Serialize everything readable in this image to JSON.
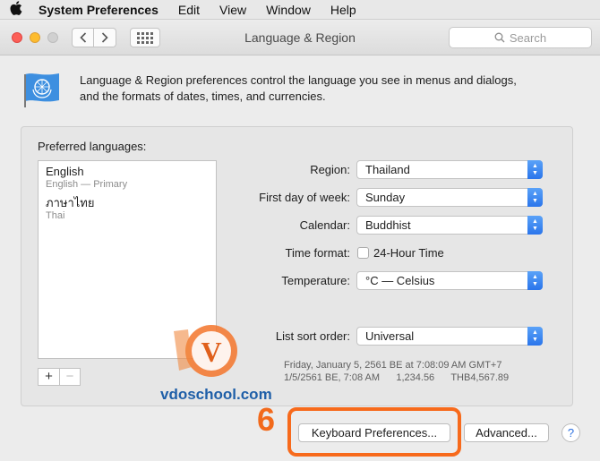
{
  "menubar": {
    "apple_icon": "apple-logo",
    "items": [
      "System Preferences",
      "Edit",
      "View",
      "Window",
      "Help"
    ]
  },
  "window": {
    "title": "Language & Region",
    "search_placeholder": "Search"
  },
  "intro": {
    "icon": "un-flag-icon",
    "text_line1": "Language & Region preferences control the language you see in menus and dialogs,",
    "text_line2": "and the formats of dates, times, and currencies."
  },
  "languages": {
    "label": "Preferred languages:",
    "items": [
      {
        "name": "English",
        "sub": "English — Primary"
      },
      {
        "name": "ภาษาไทย",
        "sub": "Thai"
      }
    ],
    "add": "+",
    "remove": "−"
  },
  "settings": {
    "region_label": "Region:",
    "region_value": "Thailand",
    "first_day_label": "First day of week:",
    "first_day_value": "Sunday",
    "calendar_label": "Calendar:",
    "calendar_value": "Buddhist",
    "time_format_label": "Time format:",
    "time_format_checkbox": "24-Hour Time",
    "time_format_checked": false,
    "temperature_label": "Temperature:",
    "temperature_value": "°C — Celsius",
    "sort_order_label": "List sort order:",
    "sort_order_value": "Universal"
  },
  "sample": {
    "line1": "Friday, January 5, 2561 BE at 7:08:09 AM GMT+7",
    "line2": "1/5/2561 BE, 7:08 AM      1,234.56      THB4,567.89"
  },
  "buttons": {
    "keyboard": "Keyboard Preferences...",
    "advanced": "Advanced...",
    "help": "?"
  },
  "annotation": {
    "step": "6",
    "highlight_color": "#f76a1c"
  },
  "watermark": {
    "site": "vdoschool.com",
    "logo_letter": "V"
  },
  "colors": {
    "popup_accent": "#2a75eb",
    "close": "#fc5f57",
    "minimize": "#fdbc2e"
  }
}
